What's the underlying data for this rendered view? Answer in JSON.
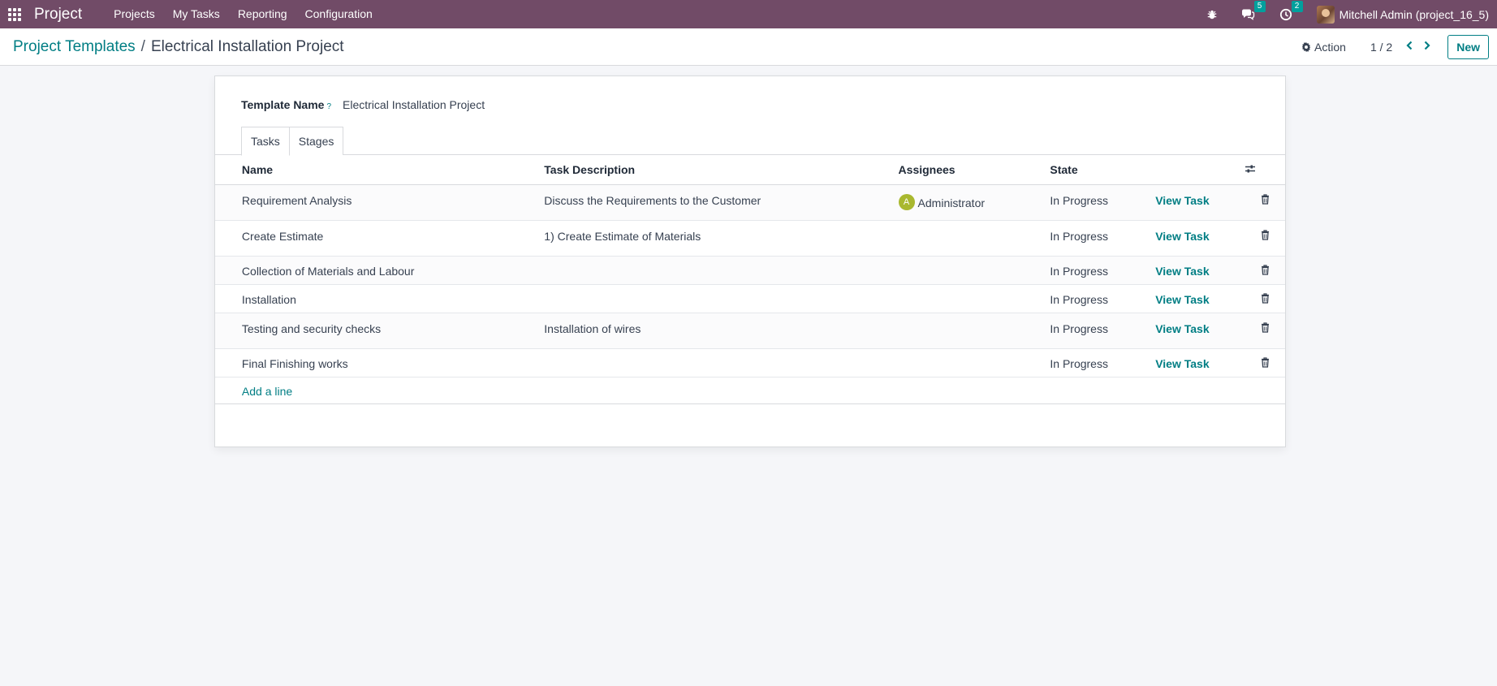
{
  "navbar": {
    "app_name": "Project",
    "menu": [
      "Projects",
      "My Tasks",
      "Reporting",
      "Configuration"
    ],
    "messages_count": "5",
    "activities_count": "2",
    "user_name": "Mitchell Admin (project_16_5)",
    "color": "#714b67"
  },
  "breadcrumb": {
    "parent": "Project Templates",
    "separator": "/",
    "current": "Electrical Installation Project"
  },
  "control": {
    "action_label": "Action",
    "pager": "1 / 2",
    "new_label": "New"
  },
  "form": {
    "template_label": "Template Name",
    "help_mark": "?",
    "template_value": "Electrical Installation Project",
    "tabs": [
      "Tasks",
      "Stages"
    ],
    "columns": {
      "name": "Name",
      "description": "Task Description",
      "assignees": "Assignees",
      "state": "State"
    },
    "rows": [
      {
        "name": "Requirement Analysis",
        "description": "Discuss the Requirements to the Customer",
        "assignee": "Administrator",
        "assignee_initial": "A",
        "state": "In Progress",
        "view": "View Task"
      },
      {
        "name": "Create Estimate",
        "description": "1) Create Estimate of Materials",
        "assignee": "",
        "assignee_initial": "",
        "state": "In Progress",
        "view": "View Task"
      },
      {
        "name": "Collection of Materials and Labour",
        "description": "",
        "assignee": "",
        "assignee_initial": "",
        "state": "In Progress",
        "view": "View Task"
      },
      {
        "name": "Installation",
        "description": "",
        "assignee": "",
        "assignee_initial": "",
        "state": "In Progress",
        "view": "View Task"
      },
      {
        "name": "Testing and security checks",
        "description": "Installation of wires",
        "assignee": "",
        "assignee_initial": "",
        "state": "In Progress",
        "view": "View Task"
      },
      {
        "name": "Final Finishing works",
        "description": "",
        "assignee": "",
        "assignee_initial": "",
        "state": "In Progress",
        "view": "View Task"
      }
    ],
    "add_line": "Add a line"
  },
  "colors": {
    "accent": "#017e84",
    "assignee_avatar": "#a9b82f",
    "badge": "#00a09d"
  },
  "icons": [
    "apps-icon",
    "bug-icon",
    "chat-icon",
    "clock-icon",
    "gear-icon",
    "chevron-left-icon",
    "chevron-right-icon",
    "column-settings-icon",
    "trash-icon"
  ]
}
